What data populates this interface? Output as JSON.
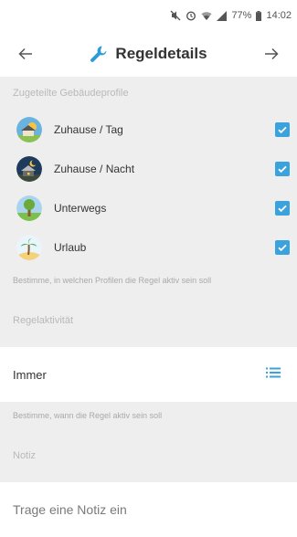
{
  "status_bar": {
    "battery": "77%",
    "time": "14:02",
    "icons": [
      "mute-icon",
      "alarm-icon",
      "wifi-icon",
      "signal-icon",
      "battery-icon"
    ]
  },
  "header": {
    "title": "Regeldetails",
    "back_icon": "arrow-left-icon",
    "forward_icon": "arrow-right-icon",
    "title_icon": "wrench-icon"
  },
  "profiles_section": {
    "heading": "Zugeteilte Gebäudeprofile",
    "items": [
      {
        "label": "Zuhause / Tag",
        "checked": true,
        "icon": "house-day-icon"
      },
      {
        "label": "Zuhause / Nacht",
        "checked": true,
        "icon": "house-night-icon"
      },
      {
        "label": "Unterwegs",
        "checked": true,
        "icon": "tree-icon"
      },
      {
        "label": "Urlaub",
        "checked": true,
        "icon": "palm-island-icon"
      }
    ],
    "hint": "Bestimme, in welchen Profilen die Regel aktiv sein soll"
  },
  "activity_section": {
    "heading": "Regelaktivität",
    "value": "Immer",
    "hint": "Bestimme, wann die Regel aktiv sein soll",
    "icon": "list-icon"
  },
  "note_section": {
    "heading": "Notiz",
    "placeholder": "Trage eine Notiz ein"
  },
  "colors": {
    "accent": "#3aa3dd",
    "section_bg": "#eeeeee",
    "wrench": "#2f9bd6"
  }
}
